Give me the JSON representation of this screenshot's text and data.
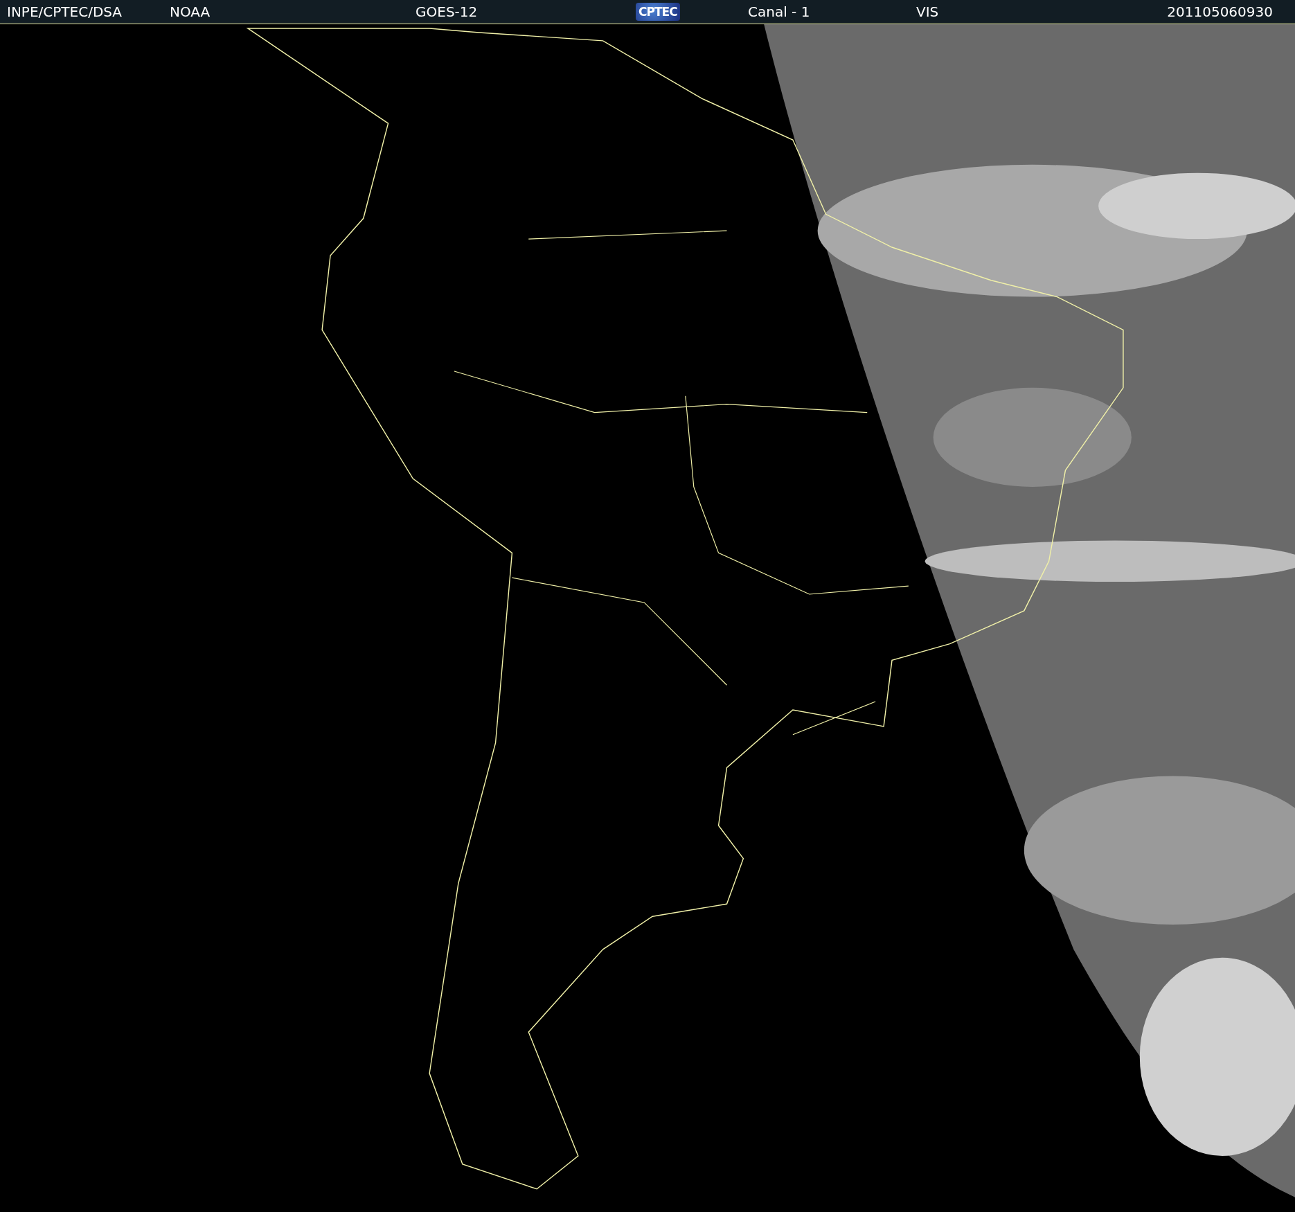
{
  "header": {
    "items": [
      {
        "kind": "text",
        "text": "INPE/CPTEC/DSA"
      },
      {
        "kind": "text",
        "text": "NOAA"
      },
      {
        "kind": "text",
        "text": "GOES-12"
      },
      {
        "kind": "logo",
        "text": "CPTEC"
      },
      {
        "kind": "text",
        "text": "Canal - 1"
      },
      {
        "kind": "text",
        "text": "VIS"
      },
      {
        "kind": "text",
        "text": "201105060930"
      }
    ]
  }
}
